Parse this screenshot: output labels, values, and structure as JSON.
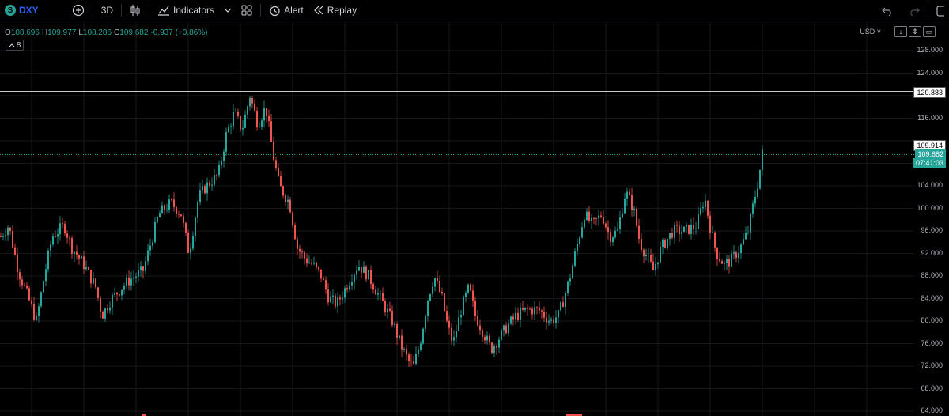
{
  "toolbar": {
    "symbol": "DXY",
    "symbol_badge": "S",
    "timeframe": "3D",
    "indicators_label": "Indicators",
    "alert_label": "Alert",
    "replay_label": "Replay"
  },
  "legend": {
    "open_key": "O",
    "open": "108.696",
    "high_key": "H",
    "high": "109.977",
    "low_key": "L",
    "low": "108.286",
    "close_key": "C",
    "close": "109.682",
    "change": "-0.937 (+0.86%)",
    "collapse_count": "8"
  },
  "price_axis": {
    "currency": "USD",
    "ticks": [
      "128.000",
      "124.000",
      "116.000",
      "104.000",
      "100.000",
      "96.000",
      "92.000",
      "88.000",
      "84.000",
      "80.000",
      "76.000",
      "72.000",
      "68.000",
      "64.000"
    ]
  },
  "horizontal_lines": {
    "upper_label": "120.883",
    "lower_label": "109.914"
  },
  "last_price": {
    "price": "109.682",
    "countdown": "07:41:03"
  },
  "colors": {
    "up": "#26a69a",
    "down": "#ef5350",
    "background": "#000000",
    "accent": "#2962ff"
  }
}
